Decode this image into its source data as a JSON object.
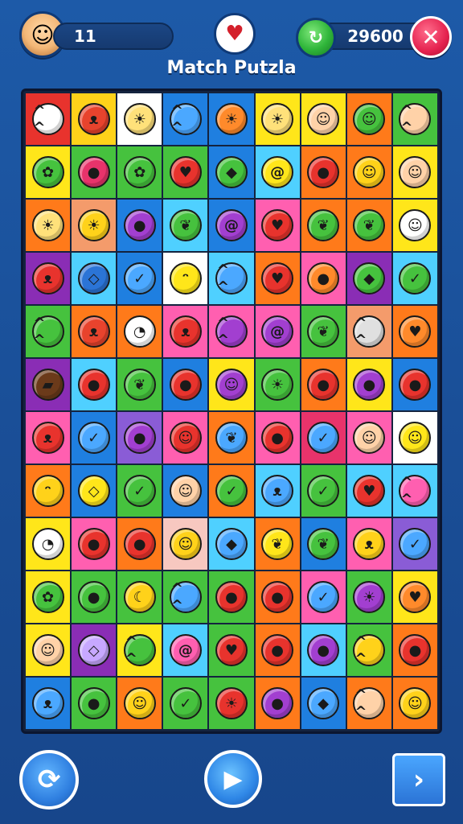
{
  "header": {
    "level": "11",
    "title": "Match Putzla",
    "score": "29600",
    "center_icon": "♥",
    "avatar_icon": "☺",
    "coin_icon": "↻",
    "close_icon": "✕"
  },
  "footer": {
    "restart_icon": "⟳",
    "play_icon": "▶",
    "next_icon": "›"
  },
  "board": {
    "columns": 9,
    "rows": 12,
    "tiles": [
      [
        {
          "bg": "#e8332d",
          "fg": "#ffffff",
          "name": "cat"
        },
        {
          "bg": "#ffd21a",
          "fg": "#e8432d",
          "name": "devil"
        },
        {
          "bg": "#ffffff",
          "fg": "#ffe17a",
          "name": "sun"
        },
        {
          "bg": "#1f7fe0",
          "fg": "#4ba8ff",
          "name": "cat"
        },
        {
          "bg": "#1f7fe0",
          "fg": "#ff8a2b",
          "name": "sun"
        },
        {
          "bg": "#ffe61a",
          "fg": "#ffe17a",
          "name": "sun"
        },
        {
          "bg": "#ffe61a",
          "fg": "#ffd2a8",
          "name": "face"
        },
        {
          "bg": "#ff7a1a",
          "fg": "#46c23e",
          "name": "face"
        },
        {
          "bg": "#46c23e",
          "fg": "#ffd2a8",
          "name": "cat"
        }
      ],
      [
        {
          "bg": "#ffe61a",
          "fg": "#46c23e",
          "name": "bush"
        },
        {
          "bg": "#46c23e",
          "fg": "#e8336b",
          "name": "berry"
        },
        {
          "bg": "#46c23e",
          "fg": "#46c23e",
          "name": "bush"
        },
        {
          "bg": "#46c23e",
          "fg": "#e8332d",
          "name": "heart"
        },
        {
          "bg": "#1f7fe0",
          "fg": "#46c23e",
          "name": "drop"
        },
        {
          "bg": "#4fd0ff",
          "fg": "#ffe61a",
          "name": "swirl"
        },
        {
          "bg": "#ff7a1a",
          "fg": "#e8332d",
          "name": "tomato"
        },
        {
          "bg": "#ff7a1a",
          "fg": "#ffd21a",
          "name": "face"
        },
        {
          "bg": "#ffe61a",
          "fg": "#ffd2a8",
          "name": "face"
        }
      ],
      [
        {
          "bg": "#ff7a1a",
          "fg": "#ffe17a",
          "name": "sun"
        },
        {
          "bg": "#f49b6b",
          "fg": "#ffd21a",
          "name": "sun"
        },
        {
          "bg": "#1f7fe0",
          "fg": "#a23fd0",
          "name": "plum"
        },
        {
          "bg": "#4fd0ff",
          "fg": "#46c23e",
          "name": "leaf"
        },
        {
          "bg": "#1f7fe0",
          "fg": "#a23fd0",
          "name": "swirl"
        },
        {
          "bg": "#ff5fb0",
          "fg": "#e8332d",
          "name": "heart"
        },
        {
          "bg": "#ff7a1a",
          "fg": "#46c23e",
          "name": "leaf"
        },
        {
          "bg": "#ff7a1a",
          "fg": "#46c23e",
          "name": "leaf"
        },
        {
          "bg": "#ffe61a",
          "fg": "#ffffff",
          "name": "face"
        }
      ],
      [
        {
          "bg": "#8a2db5",
          "fg": "#e8332d",
          "name": "devil"
        },
        {
          "bg": "#4fd0ff",
          "fg": "#2b74d6",
          "name": "gem"
        },
        {
          "bg": "#1f7fe0",
          "fg": "#4ba8ff",
          "name": "bubble"
        },
        {
          "bg": "#ffffff",
          "fg": "#ffe61a",
          "name": "chick"
        },
        {
          "bg": "#4fd0ff",
          "fg": "#4ba8ff",
          "name": "cat"
        },
        {
          "bg": "#ff7a1a",
          "fg": "#e8332d",
          "name": "heart"
        },
        {
          "bg": "#ff5fb0",
          "fg": "#ff8a2b",
          "name": "berry"
        },
        {
          "bg": "#8a2db5",
          "fg": "#46c23e",
          "name": "drop"
        },
        {
          "bg": "#4fd0ff",
          "fg": "#46c23e",
          "name": "bubble"
        }
      ],
      [
        {
          "bg": "#46c23e",
          "fg": "#46c23e",
          "name": "cat"
        },
        {
          "bg": "#ff7a1a",
          "fg": "#e8432d",
          "name": "devil"
        },
        {
          "bg": "#ff7a1a",
          "fg": "#ffffff",
          "name": "ghost"
        },
        {
          "bg": "#ff5fb0",
          "fg": "#e8332d",
          "name": "devil"
        },
        {
          "bg": "#ff5fb0",
          "fg": "#a23fd0",
          "name": "cat"
        },
        {
          "bg": "#ff5fb0",
          "fg": "#a23fd0",
          "name": "swirl"
        },
        {
          "bg": "#46c23e",
          "fg": "#46c23e",
          "name": "leaf"
        },
        {
          "bg": "#f49b6b",
          "fg": "#e0e0e0",
          "name": "cat"
        },
        {
          "bg": "#ff7a1a",
          "fg": "#ff8a2b",
          "name": "heart"
        }
      ],
      [
        {
          "bg": "#8a2db5",
          "fg": "#6b3a1a",
          "name": "hat"
        },
        {
          "bg": "#4fd0ff",
          "fg": "#e8332d",
          "name": "berry"
        },
        {
          "bg": "#46c23e",
          "fg": "#46c23e",
          "name": "leaf"
        },
        {
          "bg": "#1f7fe0",
          "fg": "#e8332d",
          "name": "apple"
        },
        {
          "bg": "#ffe61a",
          "fg": "#a23fd0",
          "name": "face"
        },
        {
          "bg": "#46c23e",
          "fg": "#46c23e",
          "name": "sun"
        },
        {
          "bg": "#ff7a1a",
          "fg": "#e8332d",
          "name": "tomato"
        },
        {
          "bg": "#ffe61a",
          "fg": "#a23fd0",
          "name": "plum"
        },
        {
          "bg": "#1f7fe0",
          "fg": "#e8332d",
          "name": "tomato"
        }
      ],
      [
        {
          "bg": "#ff5fb0",
          "fg": "#e8332d",
          "name": "devil"
        },
        {
          "bg": "#1f7fe0",
          "fg": "#4ba8ff",
          "name": "bubble"
        },
        {
          "bg": "#8a5cd6",
          "fg": "#a23fd0",
          "name": "plum"
        },
        {
          "bg": "#ff5fb0",
          "fg": "#e8332d",
          "name": "face"
        },
        {
          "bg": "#ff7a1a",
          "fg": "#4ba8ff",
          "name": "leaf"
        },
        {
          "bg": "#ff5fb0",
          "fg": "#e8332d",
          "name": "berry"
        },
        {
          "bg": "#e8336b",
          "fg": "#4ba8ff",
          "name": "bubble"
        },
        {
          "bg": "#ff5fb0",
          "fg": "#ffd2a8",
          "name": "face"
        },
        {
          "bg": "#ffffff",
          "fg": "#ffe61a",
          "name": "face"
        }
      ],
      [
        {
          "bg": "#ff7a1a",
          "fg": "#ffd21a",
          "name": "chick"
        },
        {
          "bg": "#1f7fe0",
          "fg": "#ffe61a",
          "name": "gem"
        },
        {
          "bg": "#46c23e",
          "fg": "#46c23e",
          "name": "bubble"
        },
        {
          "bg": "#1f7fe0",
          "fg": "#ffd2a8",
          "name": "face"
        },
        {
          "bg": "#ff7a1a",
          "fg": "#46c23e",
          "name": "bubble"
        },
        {
          "bg": "#4fd0ff",
          "fg": "#4ba8ff",
          "name": "devil"
        },
        {
          "bg": "#46c23e",
          "fg": "#46c23e",
          "name": "bubble"
        },
        {
          "bg": "#4fd0ff",
          "fg": "#e8332d",
          "name": "heart"
        },
        {
          "bg": "#4fd0ff",
          "fg": "#ff5fb0",
          "name": "cat"
        }
      ],
      [
        {
          "bg": "#ffe61a",
          "fg": "#ffffff",
          "name": "ghost"
        },
        {
          "bg": "#ff5fb0",
          "fg": "#e8332d",
          "name": "berry"
        },
        {
          "bg": "#ff7a1a",
          "fg": "#e8332d",
          "name": "berry"
        },
        {
          "bg": "#f7c8c0",
          "fg": "#ffd21a",
          "name": "face"
        },
        {
          "bg": "#4fd0ff",
          "fg": "#4ba8ff",
          "name": "drop"
        },
        {
          "bg": "#ff7a1a",
          "fg": "#ffe61a",
          "name": "leaf"
        },
        {
          "bg": "#1f7fe0",
          "fg": "#46c23e",
          "name": "leaf"
        },
        {
          "bg": "#ff5fb0",
          "fg": "#ffd21a",
          "name": "devil"
        },
        {
          "bg": "#8a5cd6",
          "fg": "#4ba8ff",
          "name": "bubble"
        }
      ],
      [
        {
          "bg": "#ffe61a",
          "fg": "#46c23e",
          "name": "bush"
        },
        {
          "bg": "#46c23e",
          "fg": "#46c23e",
          "name": "berry"
        },
        {
          "bg": "#46c23e",
          "fg": "#ffd21a",
          "name": "banana"
        },
        {
          "bg": "#46c23e",
          "fg": "#4ba8ff",
          "name": "cat"
        },
        {
          "bg": "#46c23e",
          "fg": "#e8332d",
          "name": "tomato"
        },
        {
          "bg": "#ff7a1a",
          "fg": "#e8332d",
          "name": "tomato"
        },
        {
          "bg": "#ff5fb0",
          "fg": "#4ba8ff",
          "name": "bubble"
        },
        {
          "bg": "#46c23e",
          "fg": "#a23fd0",
          "name": "sun"
        },
        {
          "bg": "#ffe61a",
          "fg": "#ff8a2b",
          "name": "heart"
        }
      ],
      [
        {
          "bg": "#ffe61a",
          "fg": "#ffd2a8",
          "name": "face"
        },
        {
          "bg": "#8a2db5",
          "fg": "#c7a8ff",
          "name": "gem"
        },
        {
          "bg": "#ffe61a",
          "fg": "#46c23e",
          "name": "cat"
        },
        {
          "bg": "#4fd0ff",
          "fg": "#ff5fb0",
          "name": "swirl"
        },
        {
          "bg": "#46c23e",
          "fg": "#e8332d",
          "name": "heart"
        },
        {
          "bg": "#ff7a1a",
          "fg": "#e8332d",
          "name": "tomato"
        },
        {
          "bg": "#4fd0ff",
          "fg": "#a23fd0",
          "name": "plum"
        },
        {
          "bg": "#46c23e",
          "fg": "#ffd21a",
          "name": "cat"
        },
        {
          "bg": "#ff7a1a",
          "fg": "#e8332d",
          "name": "apple"
        }
      ],
      [
        {
          "bg": "#1f7fe0",
          "fg": "#4ba8ff",
          "name": "devil"
        },
        {
          "bg": "#46c23e",
          "fg": "#46c23e",
          "name": "berry"
        },
        {
          "bg": "#ff7a1a",
          "fg": "#ffd21a",
          "name": "face"
        },
        {
          "bg": "#46c23e",
          "fg": "#46c23e",
          "name": "bubble"
        },
        {
          "bg": "#46c23e",
          "fg": "#e8332d",
          "name": "sun"
        },
        {
          "bg": "#ff7a1a",
          "fg": "#a23fd0",
          "name": "plum"
        },
        {
          "bg": "#1f7fe0",
          "fg": "#4ba8ff",
          "name": "drop"
        },
        {
          "bg": "#ff7a1a",
          "fg": "#ffd2a8",
          "name": "cat"
        },
        {
          "bg": "#ff7a1a",
          "fg": "#ffd21a",
          "name": "face"
        }
      ]
    ]
  }
}
